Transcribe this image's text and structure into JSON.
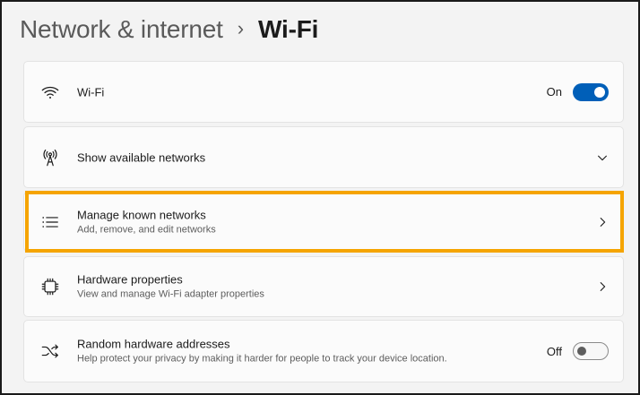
{
  "breadcrumb": {
    "parent": "Network & internet",
    "separator": "›",
    "current": "Wi-Fi"
  },
  "cards": [
    {
      "icon": "wifi-icon",
      "title": "Wi-Fi",
      "state": "On",
      "control": "toggle",
      "toggle_on": true
    },
    {
      "icon": "antenna-icon",
      "title": "Show available networks",
      "control": "chevron-down"
    },
    {
      "icon": "list-icon",
      "title": "Manage known networks",
      "subtitle": "Add, remove, and edit networks",
      "control": "chevron-right"
    },
    {
      "icon": "chip-icon",
      "title": "Hardware properties",
      "subtitle": "View and manage Wi-Fi adapter properties",
      "control": "chevron-right"
    },
    {
      "icon": "shuffle-icon",
      "title": "Random hardware addresses",
      "subtitle": "Help protect your privacy by making it harder for people to track your device location.",
      "state": "Off",
      "control": "toggle",
      "toggle_on": false
    }
  ],
  "colors": {
    "accent": "#005fb8",
    "highlight": "#f5a400",
    "background": "#f3f3f3",
    "card": "#fbfbfb"
  }
}
